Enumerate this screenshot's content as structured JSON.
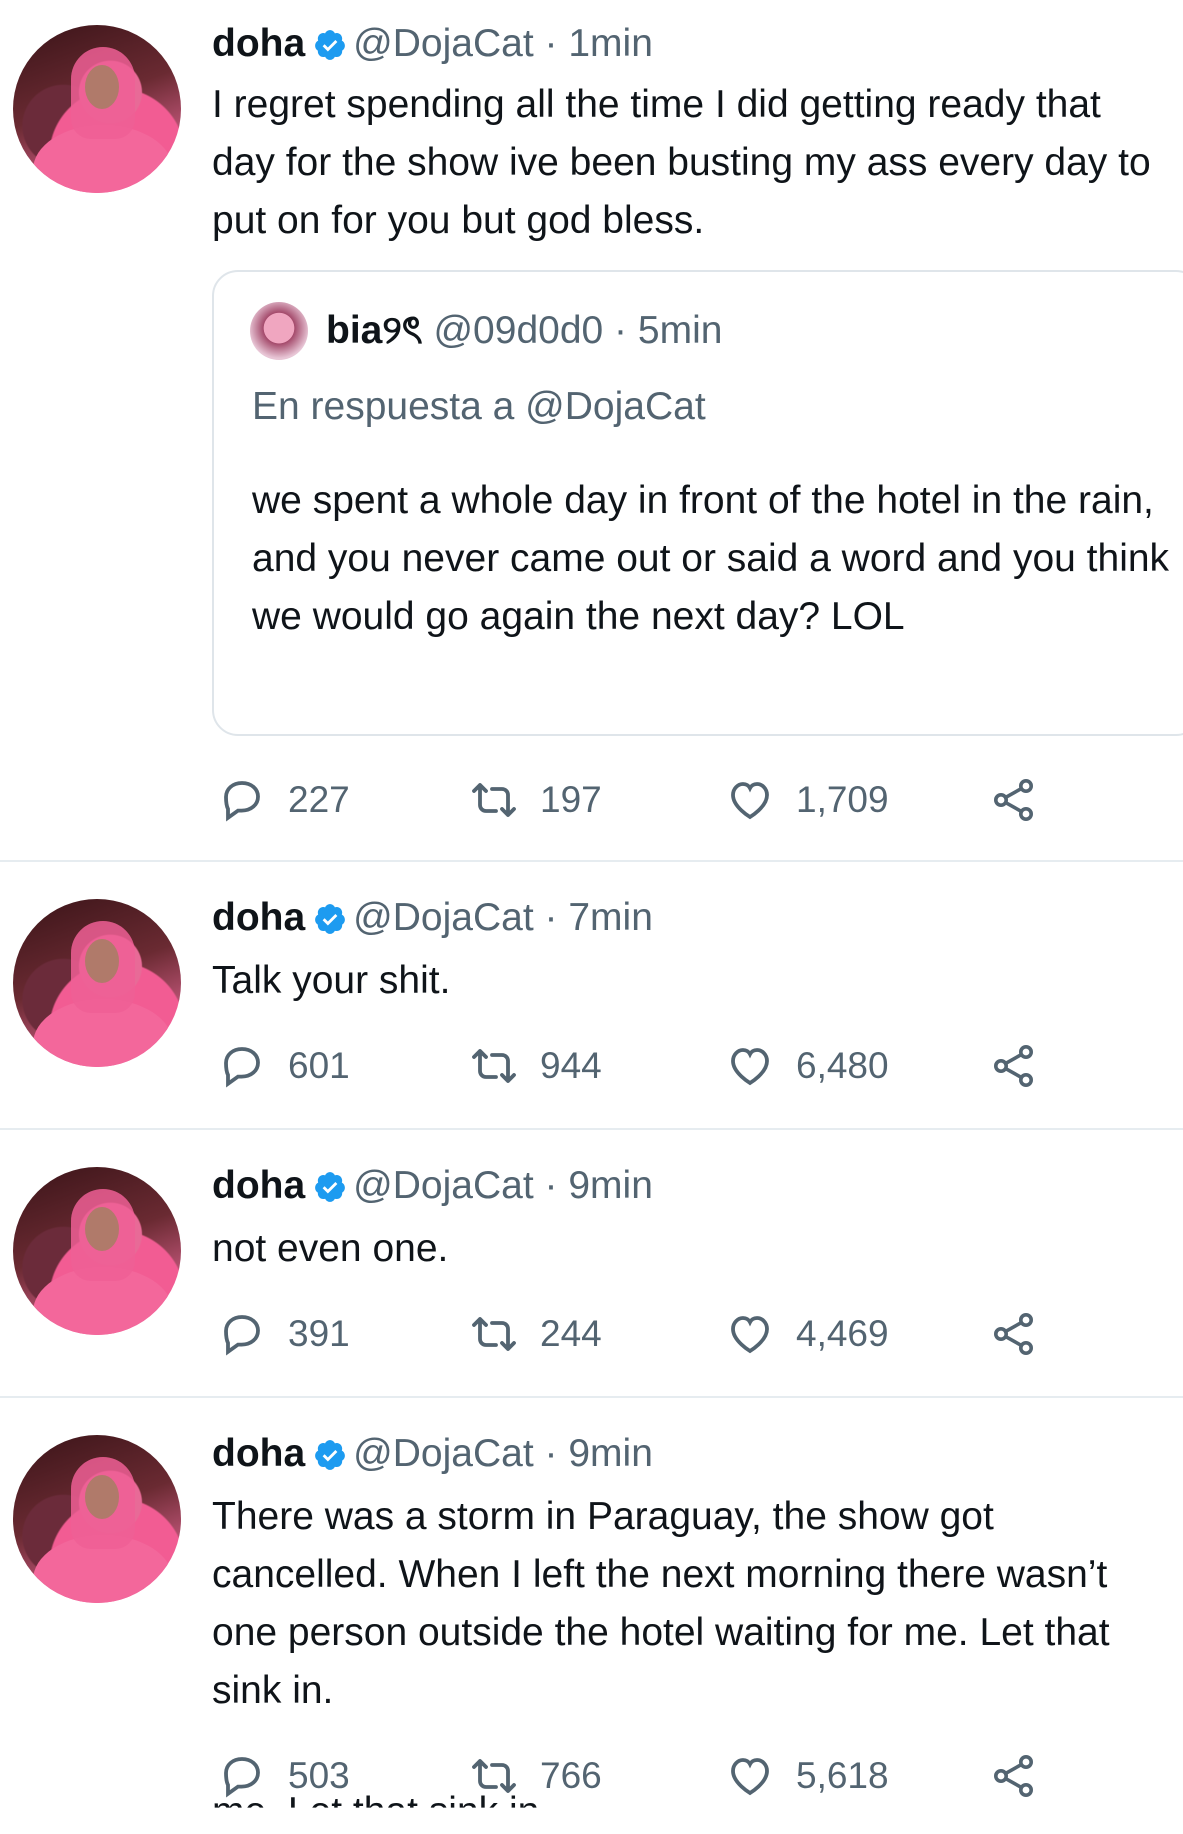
{
  "tweets": [
    {
      "name": "doha",
      "handle": "@DojaCat",
      "dot": "·",
      "time": "1min",
      "text": "I regret spending all the time I did getting ready that day for the show ive been busting my ass every day to put on for you but god bless.",
      "quote": {
        "name": "bia୨ৎ",
        "handle": "@09d0d0",
        "dot": "·",
        "time": "5min",
        "reply_to": "En respuesta a @DojaCat",
        "text": "we spent a whole day in front of the hotel in the rain, and you never came out or said a word and you think we would go again the next day? LOL"
      },
      "replies": "227",
      "retweets": "197",
      "likes": "1,709"
    },
    {
      "name": "doha",
      "handle": "@DojaCat",
      "dot": "·",
      "time": "7min",
      "text": "Talk your shit.",
      "replies": "601",
      "retweets": "944",
      "likes": "6,480"
    },
    {
      "name": "doha",
      "handle": "@DojaCat",
      "dot": "·",
      "time": "9min",
      "text": "not even one.",
      "replies": "391",
      "retweets": "244",
      "likes": "4,469"
    },
    {
      "name": "doha",
      "handle": "@DojaCat",
      "dot": "·",
      "time": "9min",
      "text": "There was a storm in Paraguay, the show got cancelled. When I left the next morning there wasn’t one person outside the hotel waiting for me. Let that sink in.",
      "replies": "503",
      "retweets": "766",
      "likes": "5,618"
    }
  ],
  "overlap_text": "me. Let that sink in.",
  "colors": {
    "text": "#0f1419",
    "secondary": "#536471",
    "verified": "#1d9bf0",
    "divider": "#e6ecf0"
  },
  "icons": [
    "verified-badge-icon",
    "reply-icon",
    "retweet-icon",
    "like-icon",
    "share-icon"
  ]
}
